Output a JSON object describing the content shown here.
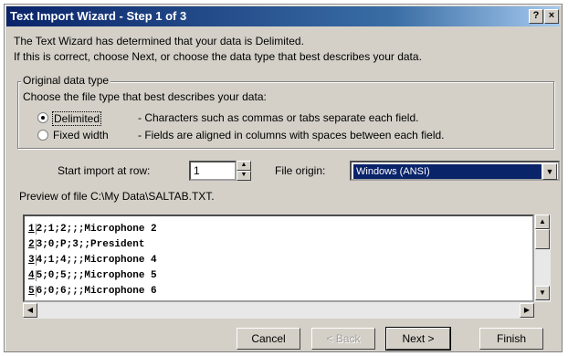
{
  "window": {
    "title": "Text Import Wizard - Step 1 of 3",
    "help": "?",
    "close": "×"
  },
  "intro": {
    "line1": "The Text Wizard has determined that your data is Delimited.",
    "line2": "If this is correct, choose Next, or choose the data type that best describes your data."
  },
  "datatype": {
    "legend": "Original data type",
    "prompt": "Choose the file type that best describes your data:",
    "options": [
      {
        "label": "Delimited",
        "desc": "- Characters such as commas or tabs separate each field.",
        "selected": true
      },
      {
        "label": "Fixed width",
        "desc": "- Fields are aligned in columns with spaces between each field.",
        "selected": false
      }
    ]
  },
  "import_row": {
    "label": "Start import at row:",
    "value": "1"
  },
  "file_origin": {
    "label": "File origin:",
    "value": "Windows (ANSI)"
  },
  "preview": {
    "label": "Preview of file C:\\My Data\\SALTAB.TXT.",
    "rows": [
      {
        "num": "1",
        "text": "2;1;2;;;Microphone 2"
      },
      {
        "num": "2",
        "text": "3;0;P;3;;President"
      },
      {
        "num": "3",
        "text": "4;1;4;;;Microphone 4"
      },
      {
        "num": "4",
        "text": "5;0;5;;;Microphone 5"
      },
      {
        "num": "5",
        "text": "6;0;6;;;Microphone 6"
      }
    ]
  },
  "buttons": {
    "cancel": "Cancel",
    "back": "< Back",
    "next": "Next >",
    "finish": "Finish"
  }
}
